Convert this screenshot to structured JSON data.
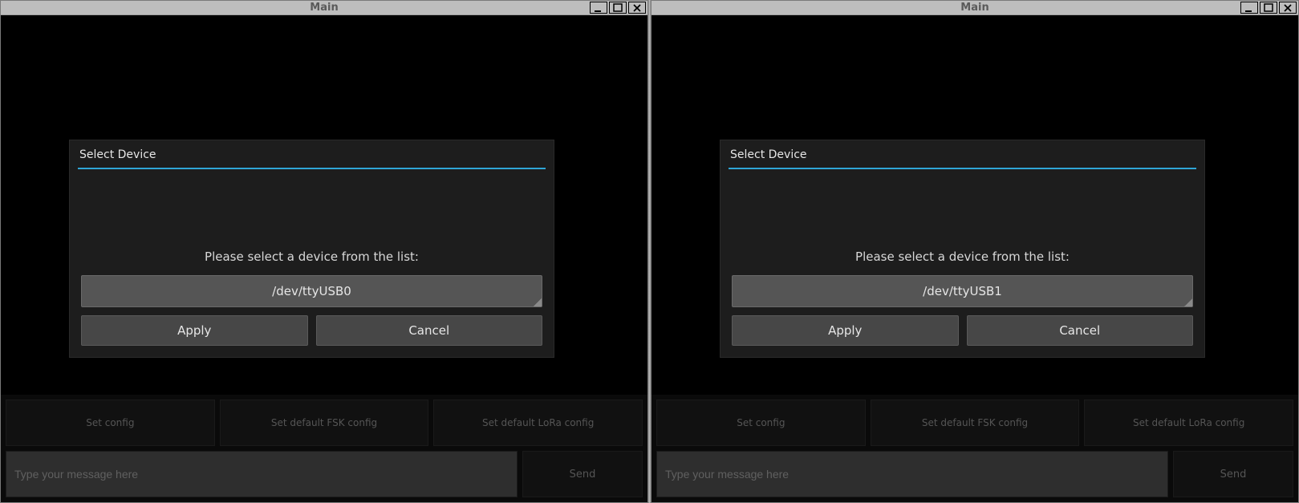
{
  "windows": [
    {
      "title": "Main",
      "dialog": {
        "title": "Select Device",
        "prompt": "Please select a device from the list:",
        "selected_device": "/dev/ttyUSB0",
        "apply_label": "Apply",
        "cancel_label": "Cancel"
      },
      "config_buttons": {
        "set_config": "Set config",
        "set_fsk": "Set default FSK config",
        "set_lora": "Set default LoRa config"
      },
      "message": {
        "placeholder": "Type your message here",
        "value": "",
        "send_label": "Send"
      }
    },
    {
      "title": "Main",
      "dialog": {
        "title": "Select Device",
        "prompt": "Please select a device from the list:",
        "selected_device": "/dev/ttyUSB1",
        "apply_label": "Apply",
        "cancel_label": "Cancel"
      },
      "config_buttons": {
        "set_config": "Set config",
        "set_fsk": "Set default FSK config",
        "set_lora": "Set default LoRa config"
      },
      "message": {
        "placeholder": "Type your message here",
        "value": "",
        "send_label": "Send"
      }
    }
  ]
}
